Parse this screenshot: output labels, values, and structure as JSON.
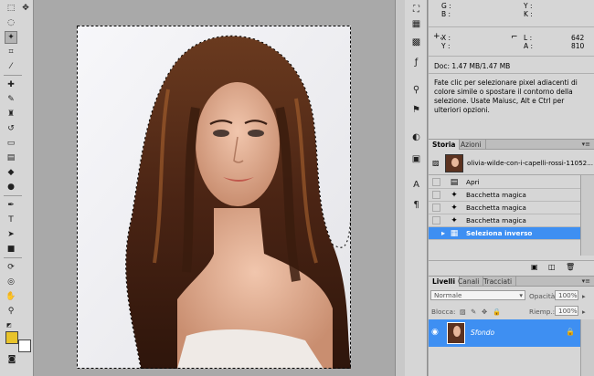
{
  "info": {
    "g_label": "G :",
    "b_label": "B :",
    "y_label": "Y :",
    "k_label": "K :",
    "x_label": "X :",
    "y2_label": "Y :",
    "l_label": "L :",
    "a_label": "A :",
    "l_value": "642",
    "a_value": "810",
    "doc_size": "Doc: 1.47 MB/1.47 MB",
    "hint": "Fate clic per selezionare pixel adiacenti di colore simile o spostare il contorno della selezione. Usate Maiusc, Alt e Ctrl per ulteriori opzioni."
  },
  "history": {
    "tabs": [
      "Storia",
      "Azioni"
    ],
    "snapshot_label": "olivia-wilde-con-i-capelli-rossi-11052...",
    "steps": [
      {
        "label": "Apri",
        "icon": "document-icon",
        "selected": false
      },
      {
        "label": "Bacchetta magica",
        "icon": "magic-wand-icon",
        "selected": false
      },
      {
        "label": "Bacchetta magica",
        "icon": "magic-wand-icon",
        "selected": false
      },
      {
        "label": "Bacchetta magica",
        "icon": "magic-wand-icon",
        "selected": false
      },
      {
        "label": "Seleziona inverso",
        "icon": "selection-icon",
        "selected": true
      }
    ]
  },
  "layers": {
    "tabs": [
      "Livelli",
      "Canali",
      "Tracciati"
    ],
    "blend_mode": "Normale",
    "opacity_label": "Opacità:",
    "opacity_value": "100%",
    "lock_label": "Blocca:",
    "fill_label": "Riemp.:",
    "fill_value": "100%",
    "layer_name": "Sfondo"
  },
  "colors": {
    "accent": "#3e8ff2",
    "foreground": "#e8c32a",
    "background": "#ffffff"
  }
}
